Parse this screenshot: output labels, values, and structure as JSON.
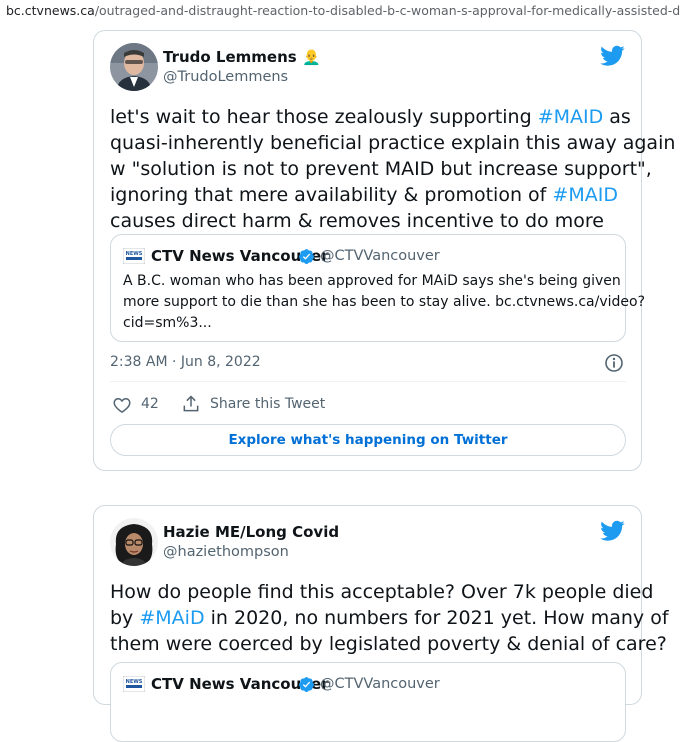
{
  "browser": {
    "url_host": "bc.ctvnews.ca",
    "url_path": "/outraged-and-distraught-reaction-to-disabled-b-c-woman-s-approval-for-medically-assisted-d"
  },
  "tweets": [
    {
      "author_name": "Trudo Lemmens",
      "author_emoji": "👨‍🦲",
      "author_handle": "@TrudoLemmens",
      "text_lines": [
        [
          {
            "t": "let's wait to hear those zealously supporting "
          },
          {
            "t": "#MAID",
            "tag": true
          },
          {
            "t": " as"
          }
        ],
        [
          {
            "t": "quasi-inherently beneficial practice explain this away again"
          }
        ],
        [
          {
            "t": "w \"solution is not to prevent MAID but increase support\","
          }
        ],
        [
          {
            "t": "ignoring that mere availability & promotion of "
          },
          {
            "t": "#MAID",
            "tag": true
          }
        ],
        [
          {
            "t": "causes direct harm & removes incentive to do more"
          }
        ]
      ],
      "quote": {
        "name": "CTV News Vancouver",
        "handle": "@CTVVancouver",
        "text_lines": [
          "A B.C. woman who has been approved for MAiD says she's being given",
          "more support to die than she has been to stay alive.  bc.ctvnews.ca/video?",
          "cid=sm%3..."
        ]
      },
      "timestamp": "2:38 AM · Jun 8, 2022",
      "likes": "42",
      "share_label": "Share this Tweet",
      "explore_label": "Explore what's happening on Twitter"
    },
    {
      "author_name": "Hazie ME/Long Covid",
      "author_handle": "@haziethompson",
      "text_lines": [
        [
          {
            "t": "How do people find this acceptable? Over 7k people died"
          }
        ],
        [
          {
            "t": "by "
          },
          {
            "t": "#MAiD",
            "tag": true
          },
          {
            "t": " in 2020, no numbers for 2021 yet. How many of"
          }
        ],
        [
          {
            "t": "them were coerced by legislated poverty & denial of care?"
          }
        ]
      ],
      "quote": {
        "name": "CTV News Vancouver",
        "handle": "@CTVVancouver"
      }
    }
  ],
  "colors": {
    "hashtag": "#1d9bf0",
    "twitter_blue": "#1d9bf0",
    "secondary_text": "#536471",
    "border": "#cfd9de"
  }
}
